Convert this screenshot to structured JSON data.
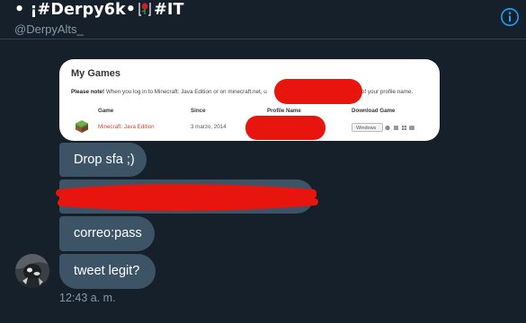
{
  "header": {
    "title_left": "• ¡#Derpy6k•",
    "title_right": "#IT",
    "handle": "@DerpyAlts_",
    "info_icon": "info-icon"
  },
  "shared_image": {
    "title": "My Games",
    "note_bold": "Please note!",
    "note_text": " When you log in to Minecraft: Java Edition or on minecraft.net, u",
    "note_end": "stead of your profile name.",
    "columns": [
      "Game",
      "Since",
      "Profile Name",
      "Download Game"
    ],
    "row": {
      "game": "Minecraft: Java Edition",
      "since": "3 marzo, 2014",
      "download_button": "Windows"
    },
    "redaction_color": "#e8140e"
  },
  "messages": [
    {
      "text": "Drop sfa ;)"
    },
    {
      "text": ""
    },
    {
      "text": "correo:pass"
    },
    {
      "text": "tweet legit?"
    }
  ],
  "timestamp": "12:43 a. m.",
  "colors": {
    "background": "#15202b",
    "bubble": "#3d5466",
    "secondary_text": "#8899a6",
    "accent": "#1da1f2"
  }
}
